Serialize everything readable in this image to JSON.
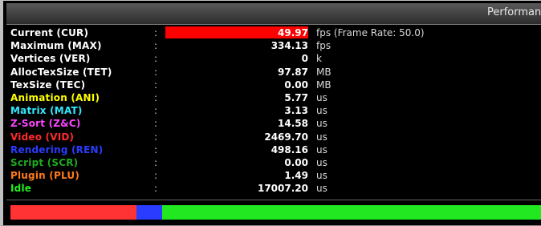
{
  "window": {
    "title": "Performance"
  },
  "colors": {
    "value_bar": "#ff0000",
    "usage_segments": [
      "#ff3333",
      "#2a3cff",
      "#22e822"
    ]
  },
  "stats": [
    {
      "label": "Current (CUR)",
      "value": "49.97",
      "unit": "fps (Frame Rate: 50.0)",
      "color": "#ffffff",
      "highlight": true
    },
    {
      "label": "Maximum (MAX)",
      "value": "334.13",
      "unit": "fps",
      "color": "#ffffff"
    },
    {
      "label": "Vertices (VER)",
      "value": "0",
      "unit": "k",
      "color": "#ffffff"
    },
    {
      "label": "AllocTexSize (TET)",
      "value": "97.87",
      "unit": "MB",
      "color": "#ffffff"
    },
    {
      "label": "TexSize (TEC)",
      "value": "0.00",
      "unit": "MB",
      "color": "#ffffff"
    },
    {
      "label": "Animation (ANI)",
      "value": "5.77",
      "unit": "us",
      "color": "#ffff00"
    },
    {
      "label": "Matrix (MAT)",
      "value": "3.13",
      "unit": "us",
      "color": "#33e8ff"
    },
    {
      "label": "Z-Sort (Z&C)",
      "value": "14.58",
      "unit": "us",
      "color": "#ff44ff"
    },
    {
      "label": "Video (VID)",
      "value": "2469.70",
      "unit": "us",
      "color": "#ff2a2a"
    },
    {
      "label": "Rendering (REN)",
      "value": "498.16",
      "unit": "us",
      "color": "#2a3cff"
    },
    {
      "label": "Script (SCR)",
      "value": "0.00",
      "unit": "us",
      "color": "#1faa1f"
    },
    {
      "label": "Plugin (PLU)",
      "value": "1.49",
      "unit": "us",
      "color": "#ff7a1a"
    },
    {
      "label": "Idle",
      "value": "17007.20",
      "unit": "us",
      "color": "#22ee22"
    }
  ],
  "usage_bar": {
    "segments": [
      {
        "name": "Video",
        "fraction": 0.2364,
        "color": "#ff3333"
      },
      {
        "name": "Rendering",
        "fraction": 0.0478,
        "color": "#2a3cff"
      },
      {
        "name": "Idle",
        "fraction": 0.7158,
        "color": "#22e822"
      }
    ]
  }
}
